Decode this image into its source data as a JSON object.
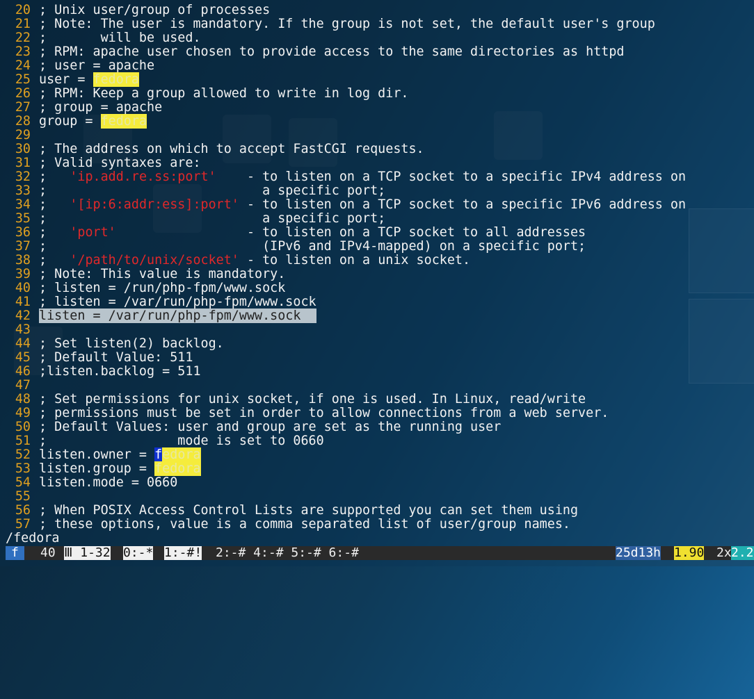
{
  "terminal": {
    "lines": [
      {
        "n": "20",
        "segments": [
          {
            "t": "; Unix user/group of processes",
            "c": ""
          }
        ]
      },
      {
        "n": "21",
        "segments": [
          {
            "t": "; Note: The user is mandatory. If the group is not set, the default user's group",
            "c": ""
          }
        ]
      },
      {
        "n": "22",
        "segments": [
          {
            "t": ";       will be used.",
            "c": ""
          }
        ]
      },
      {
        "n": "23",
        "segments": [
          {
            "t": "; RPM: apache user chosen to provide access to the same directories as httpd",
            "c": ""
          }
        ]
      },
      {
        "n": "24",
        "segments": [
          {
            "t": "; user = apache",
            "c": ""
          }
        ]
      },
      {
        "n": "25",
        "segments": [
          {
            "t": "user = ",
            "c": ""
          },
          {
            "t": "fedora",
            "c": "hl"
          }
        ]
      },
      {
        "n": "26",
        "segments": [
          {
            "t": "; RPM: Keep a group allowed to write in log dir.",
            "c": ""
          }
        ]
      },
      {
        "n": "27",
        "segments": [
          {
            "t": "; group = apache",
            "c": ""
          }
        ]
      },
      {
        "n": "28",
        "segments": [
          {
            "t": "group = ",
            "c": ""
          },
          {
            "t": "fedora",
            "c": "hl"
          }
        ]
      },
      {
        "n": "29",
        "segments": []
      },
      {
        "n": "30",
        "segments": [
          {
            "t": "; The address on which to accept FastCGI requests.",
            "c": ""
          }
        ]
      },
      {
        "n": "31",
        "segments": [
          {
            "t": "; Valid syntaxes are:",
            "c": ""
          }
        ]
      },
      {
        "n": "32",
        "segments": [
          {
            "t": ";   ",
            "c": ""
          },
          {
            "t": "'ip.add.re.ss:port'",
            "c": "str"
          },
          {
            "t": "    - to listen on a TCP socket to a specific IPv4 address on",
            "c": ""
          }
        ]
      },
      {
        "n": "33",
        "segments": [
          {
            "t": ";                            a specific port;",
            "c": ""
          }
        ]
      },
      {
        "n": "34",
        "segments": [
          {
            "t": ";   ",
            "c": ""
          },
          {
            "t": "'[ip:6:addr:ess]:port'",
            "c": "str"
          },
          {
            "t": " - to listen on a TCP socket to a specific IPv6 address on",
            "c": ""
          }
        ]
      },
      {
        "n": "35",
        "segments": [
          {
            "t": ";                            a specific port;",
            "c": ""
          }
        ]
      },
      {
        "n": "36",
        "segments": [
          {
            "t": ";   ",
            "c": ""
          },
          {
            "t": "'port'",
            "c": "str"
          },
          {
            "t": "                 - to listen on a TCP socket to all addresses",
            "c": ""
          }
        ]
      },
      {
        "n": "37",
        "segments": [
          {
            "t": ";                            (IPv6 and IPv4-mapped) on a specific port;",
            "c": ""
          }
        ]
      },
      {
        "n": "38",
        "segments": [
          {
            "t": ";   ",
            "c": ""
          },
          {
            "t": "'/path/to/unix/socket'",
            "c": "str"
          },
          {
            "t": " - to listen on a unix socket.",
            "c": ""
          }
        ]
      },
      {
        "n": "39",
        "segments": [
          {
            "t": "; Note: This value is mandatory.",
            "c": ""
          }
        ]
      },
      {
        "n": "40",
        "segments": [
          {
            "t": "; listen = /run/php-fpm/www.sock",
            "c": ""
          }
        ]
      },
      {
        "n": "41",
        "segments": [
          {
            "t": "; listen = /var/run/php-fpm/www.sock",
            "c": ""
          }
        ]
      },
      {
        "n": "42",
        "segments": [
          {
            "t": "listen = /var/run/php-fpm/www.sock  ",
            "c": "sel"
          }
        ]
      },
      {
        "n": "43",
        "segments": []
      },
      {
        "n": "44",
        "segments": [
          {
            "t": "; Set listen(2) backlog.",
            "c": ""
          }
        ]
      },
      {
        "n": "45",
        "segments": [
          {
            "t": "; Default Value: 511",
            "c": ""
          }
        ]
      },
      {
        "n": "46",
        "segments": [
          {
            "t": ";listen.backlog = 511",
            "c": ""
          }
        ]
      },
      {
        "n": "47",
        "segments": []
      },
      {
        "n": "48",
        "segments": [
          {
            "t": "; Set permissions for unix socket, if one is used. In Linux, read/write",
            "c": ""
          }
        ]
      },
      {
        "n": "49",
        "segments": [
          {
            "t": "; permissions must be set in order to allow connections from a web server.",
            "c": ""
          }
        ]
      },
      {
        "n": "50",
        "segments": [
          {
            "t": "; Default Values: user and group are set as the running user",
            "c": ""
          }
        ]
      },
      {
        "n": "51",
        "segments": [
          {
            "t": ";                 mode is set to 0660",
            "c": ""
          }
        ]
      },
      {
        "n": "52",
        "segments": [
          {
            "t": "listen.owner = ",
            "c": ""
          },
          {
            "t": "f",
            "c": "cur"
          },
          {
            "t": "edora",
            "c": "hl"
          }
        ]
      },
      {
        "n": "53",
        "segments": [
          {
            "t": "listen.group = ",
            "c": ""
          },
          {
            "t": "fedora",
            "c": "hl"
          }
        ]
      },
      {
        "n": "54",
        "segments": [
          {
            "t": "listen.mode = 0660",
            "c": ""
          }
        ]
      },
      {
        "n": "55",
        "segments": []
      },
      {
        "n": "56",
        "segments": [
          {
            "t": "; When POSIX Access Control Lists are supported you can set them using",
            "c": ""
          }
        ]
      },
      {
        "n": "57",
        "segments": [
          {
            "t": "; these options, value is a comma separated list of user/group names.",
            "c": ""
          }
        ]
      }
    ],
    "command_line": "/fedora"
  },
  "statusbar": {
    "mode": "f",
    "count": "40",
    "win_active": "Ⅲ 1-32",
    "win0": "0:-*",
    "win1": "1:-#!",
    "others": "2:-# 4:-# 5:-# 6:-#",
    "uptime": "25d13h",
    "load": "1.90",
    "cpu": "2x",
    "cpu_val": "2.2"
  },
  "colors": {
    "linenumber": "#e0a020",
    "string": "#e0282a",
    "search_highlight": "#f5ec3c",
    "cursor": "#1030d0"
  }
}
